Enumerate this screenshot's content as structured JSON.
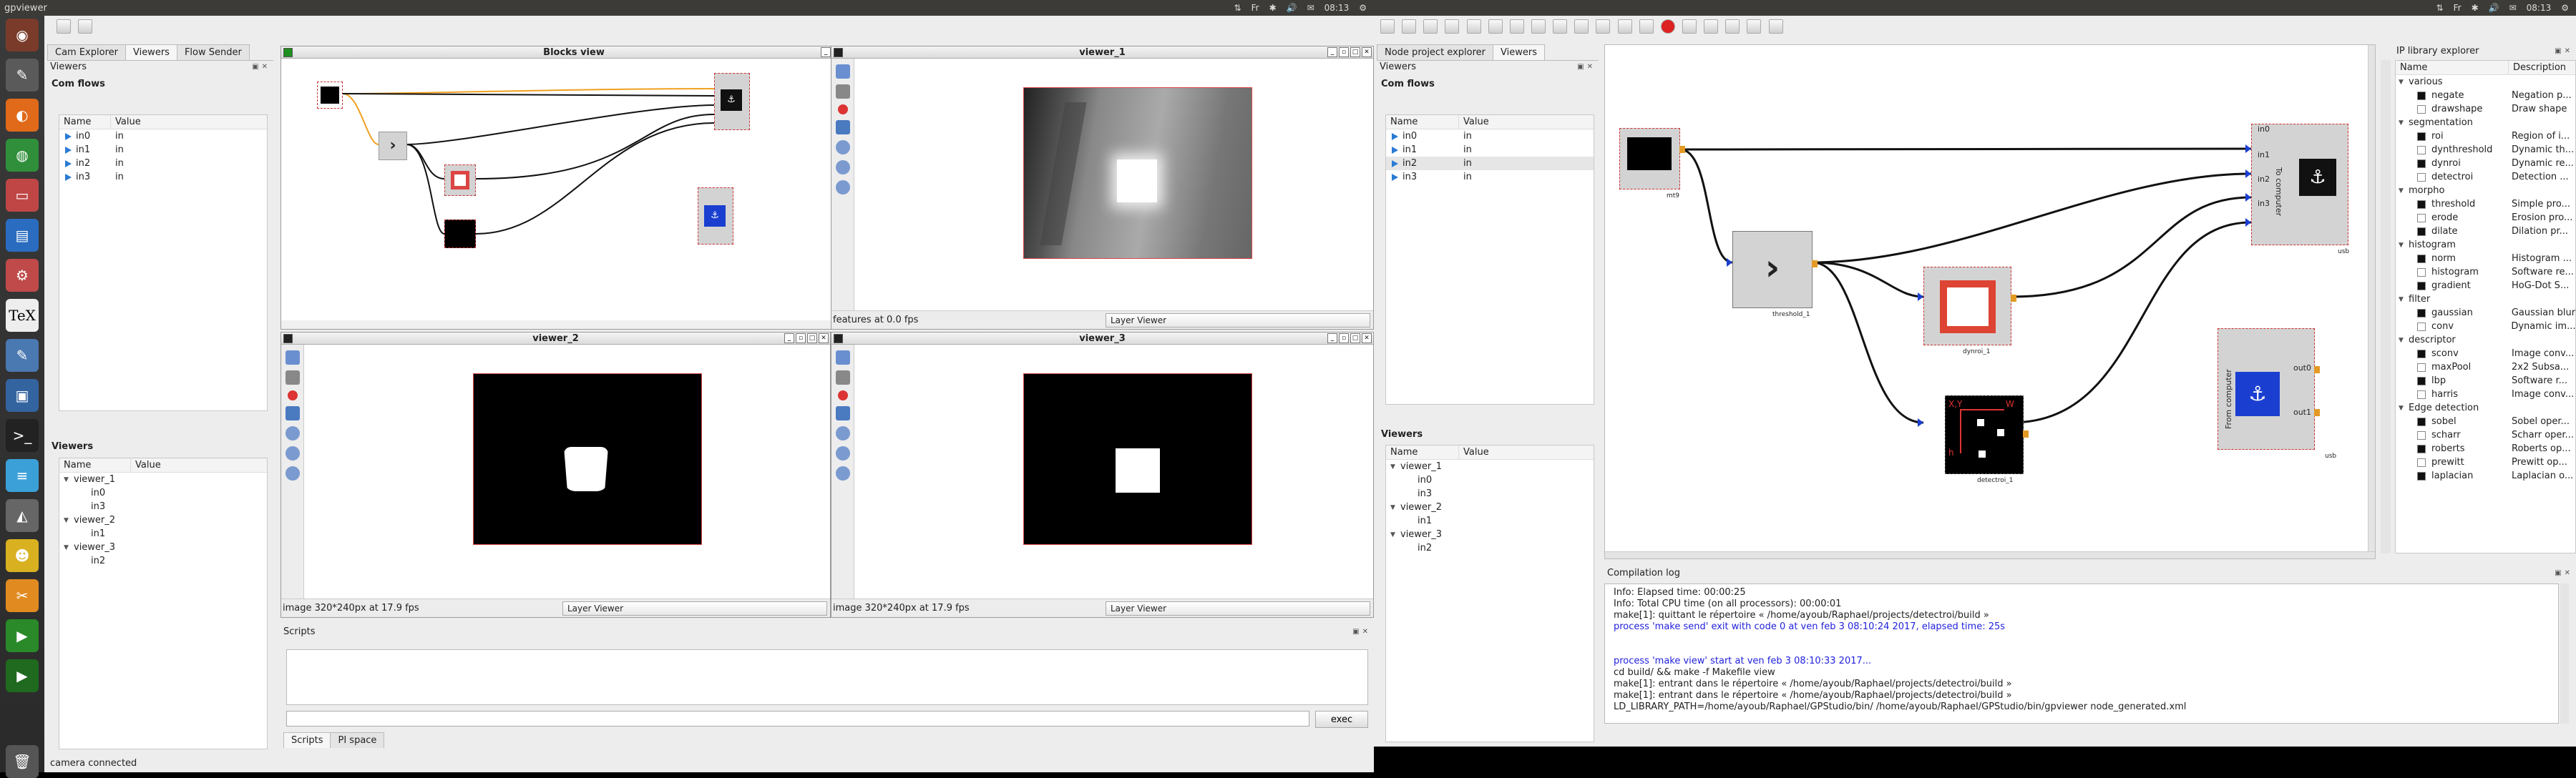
{
  "left": {
    "app_title": "gpviewer",
    "clock": "08:13",
    "lang": "Fr",
    "tabs": [
      "Cam Explorer",
      "Viewers",
      "Flow Sender"
    ],
    "viewers_dock_title": "Viewers",
    "com_flows_title": "Com flows",
    "col_name": "Name",
    "col_value": "Value",
    "flows": [
      {
        "name": "in0",
        "value": "in"
      },
      {
        "name": "in1",
        "value": "in"
      },
      {
        "name": "in2",
        "value": "in"
      },
      {
        "name": "in3",
        "value": "in"
      }
    ],
    "viewers_title": "Viewers",
    "viewers_tree": [
      {
        "name": "viewer_1",
        "children": [
          "in0",
          "in3"
        ]
      },
      {
        "name": "viewer_2",
        "children": [
          "in1"
        ]
      },
      {
        "name": "viewer_3",
        "children": [
          "in2"
        ]
      }
    ],
    "blocks_view_title": "Blocks view",
    "viewer_1_title": "viewer_1",
    "viewer_2_title": "viewer_2",
    "viewer_3_title": "viewer_3",
    "viewer_1_status": "features at 0.0 fps",
    "viewer_2_status": "image 320*240px at 17.9 fps",
    "viewer_3_status": "image 320*240px at 17.9 fps",
    "layer_viewer": "Layer Viewer",
    "scripts_title": "Scripts",
    "exec_label": "exec",
    "bottom_tabs": [
      "Scripts",
      "PI space"
    ],
    "status": "camera connected"
  },
  "right": {
    "clock": "08:13",
    "lang": "Fr",
    "tabs": [
      "Node project explorer",
      "Viewers"
    ],
    "viewers_dock_title": "Viewers",
    "com_flows_title": "Com flows",
    "col_name": "Name",
    "col_value": "Value",
    "flows": [
      {
        "name": "in0",
        "value": "in"
      },
      {
        "name": "in1",
        "value": "in"
      },
      {
        "name": "in2",
        "value": "in"
      },
      {
        "name": "in3",
        "value": "in"
      }
    ],
    "viewers_title": "Viewers",
    "viewers_tree": [
      {
        "name": "viewer_1",
        "children": [
          "in0",
          "in3"
        ]
      },
      {
        "name": "viewer_2",
        "children": [
          "in1"
        ]
      },
      {
        "name": "viewer_3",
        "children": [
          "in2"
        ]
      }
    ],
    "ip_library_title": "IP library explorer",
    "ip_col_name": "Name",
    "ip_col_desc": "Description",
    "ip_library": [
      {
        "category": "various",
        "items": [
          {
            "name": "negate",
            "desc": "Negation p..."
          },
          {
            "name": "drawshape",
            "desc": "Draw shape"
          }
        ]
      },
      {
        "category": "segmentation",
        "items": [
          {
            "name": "roi",
            "desc": "Region of i..."
          },
          {
            "name": "dynthreshold",
            "desc": "Dynamic th..."
          },
          {
            "name": "dynroi",
            "desc": "Dynamic re..."
          },
          {
            "name": "detectroi",
            "desc": "Detection ..."
          }
        ]
      },
      {
        "category": "morpho",
        "items": [
          {
            "name": "threshold",
            "desc": "Simple pro..."
          },
          {
            "name": "erode",
            "desc": "Erosion pro..."
          },
          {
            "name": "dilate",
            "desc": "Dilation pr..."
          }
        ]
      },
      {
        "category": "histogram",
        "items": [
          {
            "name": "norm",
            "desc": "Histogram ..."
          },
          {
            "name": "histogram",
            "desc": "Software re..."
          },
          {
            "name": "gradient",
            "desc": "HoG-Dot S..."
          }
        ]
      },
      {
        "category": "filter",
        "items": [
          {
            "name": "gaussian",
            "desc": "Gaussian blur"
          },
          {
            "name": "conv",
            "desc": "Dynamic im..."
          }
        ]
      },
      {
        "category": "descriptor",
        "items": [
          {
            "name": "sconv",
            "desc": "Image conv..."
          },
          {
            "name": "maxPool",
            "desc": "2x2 Subsa..."
          },
          {
            "name": "lbp",
            "desc": "Software r..."
          },
          {
            "name": "harris",
            "desc": "Image conv..."
          }
        ]
      },
      {
        "category": "Edge detection",
        "items": [
          {
            "name": "sobel",
            "desc": "Sobel oper..."
          },
          {
            "name": "scharr",
            "desc": "Scharr oper..."
          },
          {
            "name": "roberts",
            "desc": "Roberts op..."
          },
          {
            "name": "prewitt",
            "desc": "Prewitt op..."
          },
          {
            "name": "laplacian",
            "desc": "Laplacian o..."
          }
        ]
      }
    ],
    "node": {
      "mt9": "mt9",
      "threshold": "threshold_1",
      "dynroi": "dynroi_1",
      "detectroi": "detectroi_1",
      "usb_out": "usb",
      "usb_in": "usb",
      "to_computer": "To computer",
      "from_computer": "From computer",
      "ports_in": [
        "in0",
        "in1",
        "in2",
        "in3"
      ],
      "ports_out": [
        "out0",
        "out1"
      ],
      "detect_labels": {
        "xy": "X,Y",
        "w": "W",
        "h": "h"
      }
    },
    "compilation_title": "Compilation log",
    "log": [
      {
        "text": "Info: Elapsed time: 00:00:25",
        "color": "#222222"
      },
      {
        "text": "Info: Total CPU time (on all processors): 00:00:01",
        "color": "#222222"
      },
      {
        "text": "make[1]: quittant le répertoire « /home/ayoub/Raphael/projects/detectroi/build »",
        "color": "#222222"
      },
      {
        "text": "process 'make send' exit with code 0 at ven feb 3 08:10:24 2017, elapsed time: 25s",
        "color": "#2222dd"
      },
      {
        "text": "",
        "color": "#222222"
      },
      {
        "text": "",
        "color": "#222222"
      },
      {
        "text": "process 'make view' start at ven feb 3 08:10:33 2017...",
        "color": "#2222dd"
      },
      {
        "text": "cd build/ && make -f Makefile view",
        "color": "#222222"
      },
      {
        "text": "make[1]: entrant dans le répertoire « /home/ayoub/Raphael/projects/detectroi/build »",
        "color": "#222222"
      },
      {
        "text": "make[1]: entrant dans le répertoire « /home/ayoub/Raphael/projects/detectroi/build »",
        "color": "#222222"
      },
      {
        "text": "LD_LIBRARY_PATH=/home/ayoub/Raphael/GPStudio/bin/ /home/ayoub/Raphael/GPStudio/bin/gpviewer node_generated.xml",
        "color": "#222222"
      }
    ]
  }
}
